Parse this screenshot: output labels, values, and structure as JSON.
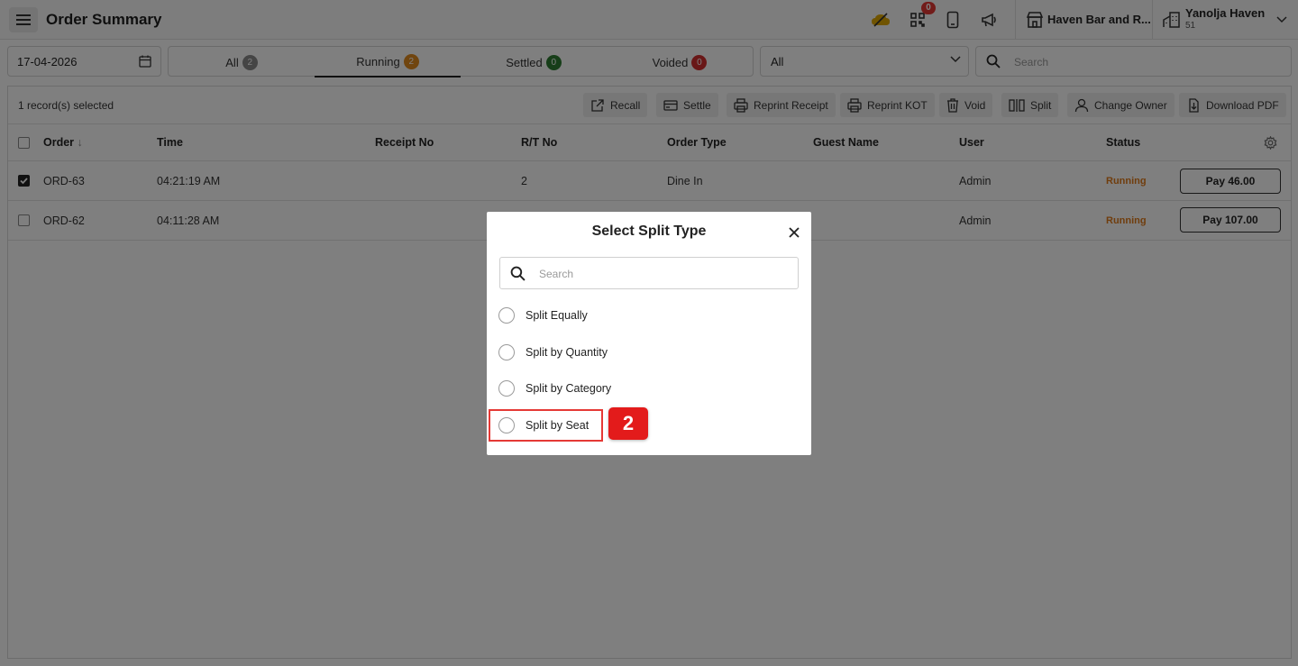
{
  "header": {
    "title": "Order Summary",
    "notification_count": "0",
    "outlet": "Haven Bar and R...",
    "user_name": "Yanolja Haven",
    "user_sub": "51",
    "icons": [
      "menu-icon",
      "cloud-sync-icon",
      "qr-scan-icon",
      "tablet-icon",
      "megaphone-icon",
      "store-icon",
      "building-icon",
      "chevron-down-icon"
    ]
  },
  "filters": {
    "date": "17-04-2026",
    "tabs": [
      {
        "label": "All",
        "count": "2",
        "color": "#8a8a8a"
      },
      {
        "label": "Running",
        "count": "2",
        "color": "#e08a1e"
      },
      {
        "label": "Settled",
        "count": "0",
        "color": "#2e7d32"
      },
      {
        "label": "Voided",
        "count": "0",
        "color": "#d32f2f"
      }
    ],
    "active_tab": "Running",
    "type_select": "All",
    "search_placeholder": "Search"
  },
  "toolbar": {
    "selection_text": "1 record(s) selected",
    "actions": [
      "Recall",
      "Settle",
      "Reprint Receipt",
      "Reprint KOT",
      "Void",
      "Split",
      "Change Owner",
      "Download PDF"
    ]
  },
  "table": {
    "columns": [
      "Order",
      "Time",
      "Receipt No",
      "R/T No",
      "Order Type",
      "Guest Name",
      "User",
      "Status"
    ],
    "rows": [
      {
        "order": "ORD-63",
        "time": "04:21:19 AM",
        "receipt": "",
        "rt": "2",
        "type": "Dine In",
        "guest": "",
        "user": "Admin",
        "status": "Running",
        "pay": "Pay 46.00",
        "checked": true
      },
      {
        "order": "ORD-62",
        "time": "04:11:28 AM",
        "receipt": "",
        "rt": "",
        "type": "",
        "guest": "",
        "user": "Admin",
        "status": "Running",
        "pay": "Pay 107.00",
        "checked": false
      }
    ]
  },
  "modal": {
    "title": "Select Split Type",
    "search_placeholder": "Search",
    "options": [
      "Split Equally",
      "Split by Quantity",
      "Split by Category",
      "Split by Seat"
    ],
    "highlighted_option": "Split by Seat",
    "step_number": "2"
  },
  "colors": {
    "accent": "#e31b1b",
    "running": "#e07b1a"
  }
}
